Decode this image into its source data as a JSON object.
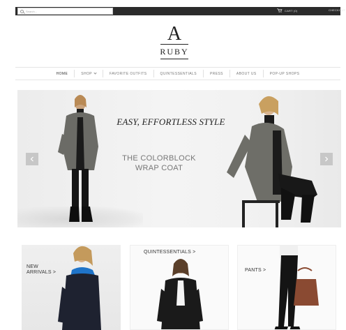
{
  "topbar": {
    "search_placeholder": "Search...",
    "cart_label": "CART (0)",
    "checkout_label": "CHECKOUT"
  },
  "logo": {
    "letter": "A",
    "name": "RUBY"
  },
  "nav": {
    "items": [
      {
        "label": "HOME"
      },
      {
        "label": "SHOP"
      },
      {
        "label": "FAVORITE OUTFITS"
      },
      {
        "label": "QUINTESSENTIALS"
      },
      {
        "label": "PRESS"
      },
      {
        "label": "ABOUT US"
      },
      {
        "label": "POP-UP SHOPS"
      }
    ]
  },
  "hero": {
    "headline": "EASY, EFFORTLESS STYLE",
    "subline_1": "THE COLORBLOCK",
    "subline_2": "WRAP COAT"
  },
  "cards": [
    {
      "label_1": "NEW",
      "label_2": "ARRIVALS >"
    },
    {
      "label": "QUINTESSENTIALS >"
    },
    {
      "label": "PANTS >"
    }
  ],
  "colors": {
    "topbar": "#2b2b2b",
    "coat_grey": "#6b6b66",
    "scarf_blue": "#1f74c9",
    "bag_brown": "#8a4a32"
  }
}
